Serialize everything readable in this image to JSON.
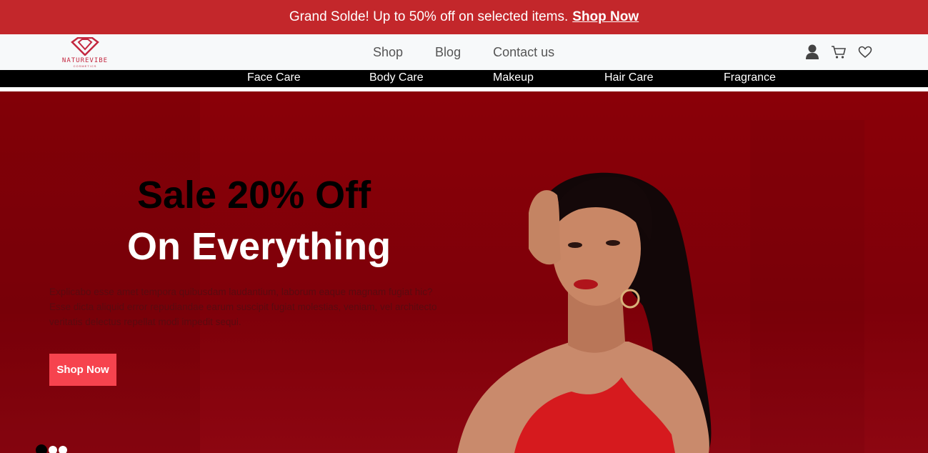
{
  "promo": {
    "text": "Grand Solde! Up to 50% off on selected items.",
    "link": "Shop Now"
  },
  "logo": {
    "name": "NATUREVIBE",
    "tagline": "COSMETICS"
  },
  "main_nav": [
    "Shop",
    "Blog",
    "Contact us"
  ],
  "header_icons": [
    "user-icon",
    "cart-icon",
    "heart-icon"
  ],
  "categories": [
    "Face Care",
    "Body Care",
    "Makeup",
    "Hair Care",
    "Fragrance"
  ],
  "hero": {
    "title_line1": "Sale 20% Off",
    "title_line2": "On Everything",
    "description": "Explicabo esse amet tempora quibusdam laudantium, laborum eaque magnam fugiat hic? Esse dicta aliquid error repudiandae earum suscipit fugiat molestias, veniam, vel architecto veritatis delectus repellat modi impedit sequi.",
    "button": "Shop Now",
    "slide_count": 3,
    "active_slide": 1
  },
  "colors": {
    "promo_bg": "#c3272b",
    "hero_bg": "#820009",
    "button_bg": "#f6434e",
    "brand": "#c3273f"
  }
}
